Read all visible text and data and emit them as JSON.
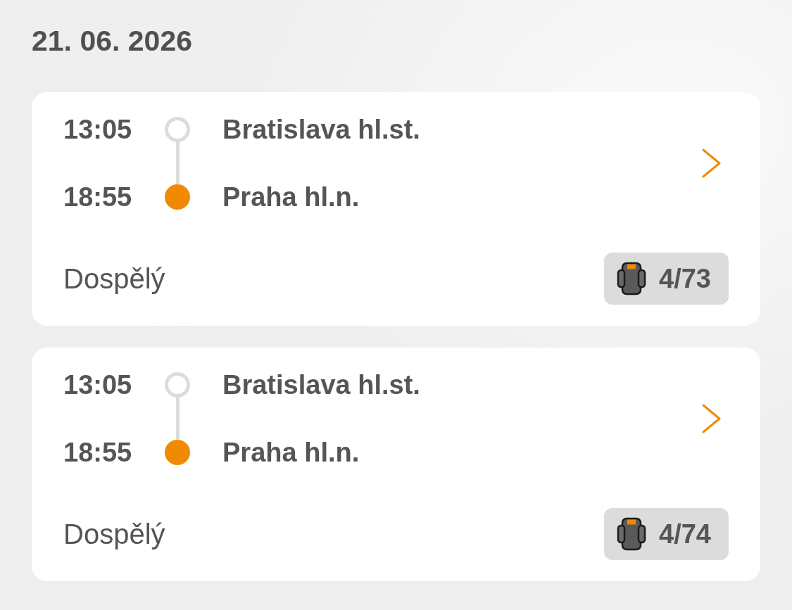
{
  "date": "21. 06. 2026",
  "trips": [
    {
      "stops": [
        {
          "time": "13:05",
          "station": "Bratislava hl.st.",
          "kind": "origin"
        },
        {
          "time": "18:55",
          "station": "Praha hl.n.",
          "kind": "destination"
        }
      ],
      "passenger": "Dospělý",
      "seats": "4/73"
    },
    {
      "stops": [
        {
          "time": "13:05",
          "station": "Bratislava hl.st.",
          "kind": "origin"
        },
        {
          "time": "18:55",
          "station": "Praha hl.n.",
          "kind": "destination"
        }
      ],
      "passenger": "Dospělý",
      "seats": "4/74"
    }
  ]
}
